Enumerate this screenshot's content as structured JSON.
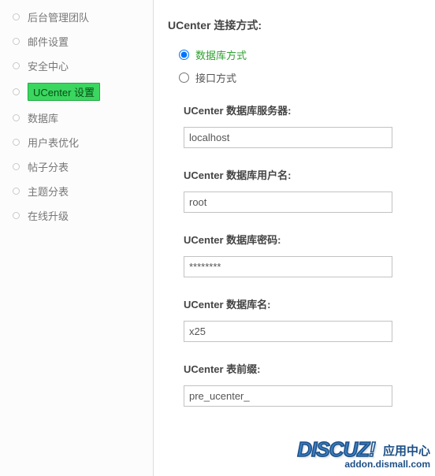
{
  "sidebar": {
    "items": [
      {
        "label": "后台管理团队"
      },
      {
        "label": "邮件设置"
      },
      {
        "label": "安全中心"
      },
      {
        "label": "UCenter 设置"
      },
      {
        "label": "数据库"
      },
      {
        "label": "用户表优化"
      },
      {
        "label": "帖子分表"
      },
      {
        "label": "主题分表"
      },
      {
        "label": "在线升级"
      }
    ],
    "active_index": 3
  },
  "main": {
    "section_title": "UCenter 连接方式:",
    "radios": [
      {
        "label": "数据库方式",
        "checked": true
      },
      {
        "label": "接口方式",
        "checked": false
      }
    ],
    "fields": [
      {
        "label": "UCenter 数据库服务器:",
        "value": "localhost",
        "type": "text"
      },
      {
        "label": "UCenter 数据库用户名:",
        "value": "root",
        "type": "text"
      },
      {
        "label": "UCenter 数据库密码:",
        "value": "********",
        "type": "password"
      },
      {
        "label": "UCenter 数据库名:",
        "value": "x25",
        "type": "text"
      },
      {
        "label": "UCenter 表前缀:",
        "value": "pre_ucenter_",
        "type": "text"
      }
    ]
  },
  "watermark": {
    "logo_main": "DISCUZ",
    "logo_bang": "!",
    "suffix": "应用中心",
    "url": "addon.dismall.com"
  }
}
